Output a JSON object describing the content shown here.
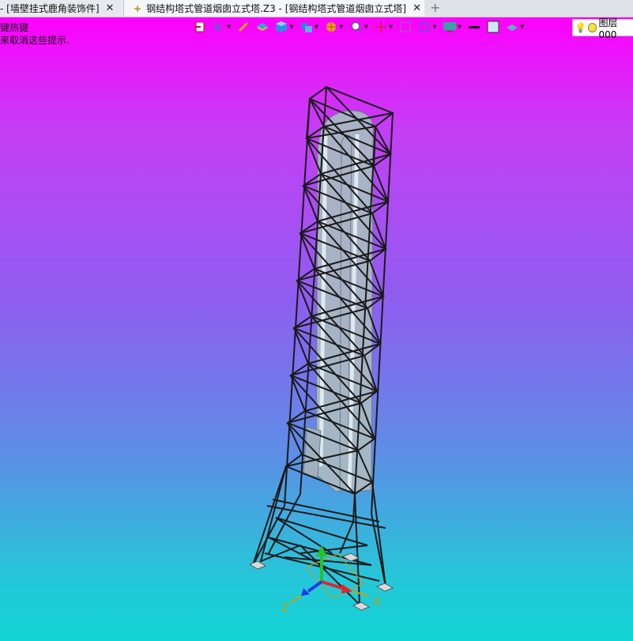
{
  "tabs": [
    {
      "label": "- [墙壁挂式鹿角装饰件]",
      "closable": true,
      "active": false
    },
    {
      "label": "钢结构塔式管道烟囱立式塔.Z3 - [钢结构塔式管道烟囱立式塔]",
      "closable": true,
      "active": true,
      "modified": true
    }
  ],
  "new_tab_label": "+",
  "close_glyph": "✕",
  "modified_glyph": "+",
  "viewport": {
    "hint_line1": "键热键",
    "hint_line2": "来取消这些提示.",
    "gradient_top": "#ff00ff",
    "gradient_bottom": "#12d4d6"
  },
  "toolbar": {
    "icons": [
      "new-window-icon",
      "pointer-pick-icon",
      "pencil-icon",
      "layers-stack-icon",
      "cube-view-icon",
      "display-mode-icon",
      "render-style-icon",
      "zoom-icon",
      "pan-crosshair-icon",
      "fit-view-icon",
      "frame-icon",
      "monitor-icon",
      "line-color-icon",
      "fill-color-icon",
      "layer-plane-icon"
    ]
  },
  "layer": {
    "label": "图层000"
  },
  "axes": {
    "x_label": "X",
    "y_label": "Y",
    "z_label": "Z"
  },
  "colors": {
    "structure": "#1a1a1a",
    "pipe": "#a9b9c4",
    "x_axis": "#e3262b",
    "y_axis": "#27c12b",
    "z_axis": "#1f38e8"
  }
}
